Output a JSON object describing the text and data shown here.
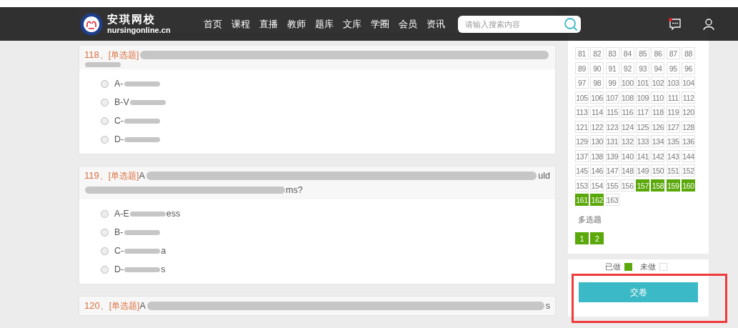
{
  "header": {
    "brand": "安琪网校",
    "domain": "nursingonline.cn",
    "nav": [
      "首页",
      "课程",
      "直播",
      "教师",
      "题库",
      "文库",
      "学圈",
      "会员",
      "资讯"
    ],
    "search": {
      "placeholder": "请输入搜索内容"
    },
    "notification_dot": true
  },
  "questions": [
    {
      "number": "118、",
      "type": "[单选题]",
      "lines": [
        [
          {
            "kind": "redacted-line"
          }
        ],
        [
          {
            "kind": "redacted-word"
          }
        ]
      ],
      "options": [
        {
          "selected": false,
          "parts": [
            {
              "kind": "text",
              "text": "A-"
            },
            {
              "kind": "redacted-word"
            }
          ]
        },
        {
          "selected": false,
          "parts": [
            {
              "kind": "text",
              "text": "B-V"
            },
            {
              "kind": "redacted-word"
            }
          ]
        },
        {
          "selected": false,
          "parts": [
            {
              "kind": "text",
              "text": "C-"
            },
            {
              "kind": "redacted-word"
            }
          ]
        },
        {
          "selected": false,
          "parts": [
            {
              "kind": "text",
              "text": "D-"
            },
            {
              "kind": "redacted-word"
            }
          ]
        }
      ]
    },
    {
      "number": "119、",
      "type": "[单选题]",
      "lines": [
        [
          {
            "kind": "text",
            "text": "A"
          },
          {
            "kind": "redacted-line"
          },
          {
            "kind": "text",
            "text": "uld"
          }
        ],
        [
          {
            "kind": "redacted-long"
          },
          {
            "kind": "text",
            "text": "ms?"
          }
        ]
      ],
      "options": [
        {
          "selected": false,
          "parts": [
            {
              "kind": "text",
              "text": "A-E"
            },
            {
              "kind": "redacted-word"
            },
            {
              "kind": "text",
              "text": "ess"
            }
          ]
        },
        {
          "selected": false,
          "parts": [
            {
              "kind": "text",
              "text": "B-"
            },
            {
              "kind": "redacted-word"
            }
          ]
        },
        {
          "selected": false,
          "parts": [
            {
              "kind": "text",
              "text": "C-"
            },
            {
              "kind": "redacted-word"
            },
            {
              "kind": "text",
              "text": "a"
            }
          ]
        },
        {
          "selected": false,
          "parts": [
            {
              "kind": "text",
              "text": "D-"
            },
            {
              "kind": "redacted-word"
            },
            {
              "kind": "text",
              "text": "s"
            }
          ]
        }
      ]
    },
    {
      "number": "120、",
      "type": "[单选题]",
      "lines": [
        [
          {
            "kind": "text",
            "text": "A"
          },
          {
            "kind": "redacted-line"
          },
          {
            "kind": "text",
            "text": "s"
          }
        ]
      ]
    }
  ],
  "answer_sheet": {
    "single": [
      {
        "label": "81",
        "answered": false
      },
      {
        "label": "82",
        "answered": false
      },
      {
        "label": "83",
        "answered": false
      },
      {
        "label": "84",
        "answered": false
      },
      {
        "label": "85",
        "answered": false
      },
      {
        "label": "86",
        "answered": false
      },
      {
        "label": "87",
        "answered": false
      },
      {
        "label": "88",
        "answered": false
      },
      {
        "label": "89",
        "answered": false
      },
      {
        "label": "90",
        "answered": false
      },
      {
        "label": "91",
        "answered": false
      },
      {
        "label": "92",
        "answered": false
      },
      {
        "label": "93",
        "answered": false
      },
      {
        "label": "94",
        "answered": false
      },
      {
        "label": "95",
        "answered": false
      },
      {
        "label": "96",
        "answered": false
      },
      {
        "label": "97",
        "answered": false
      },
      {
        "label": "98",
        "answered": false
      },
      {
        "label": "99",
        "answered": false
      },
      {
        "label": "100",
        "answered": false
      },
      {
        "label": "101",
        "answered": false
      },
      {
        "label": "102",
        "answered": false
      },
      {
        "label": "103",
        "answered": false
      },
      {
        "label": "104",
        "answered": false
      },
      {
        "label": "105",
        "answered": false
      },
      {
        "label": "106",
        "answered": false
      },
      {
        "label": "107",
        "answered": false
      },
      {
        "label": "108",
        "answered": false
      },
      {
        "label": "109",
        "answered": false
      },
      {
        "label": "110",
        "answered": false
      },
      {
        "label": "111",
        "answered": false
      },
      {
        "label": "112",
        "answered": false
      },
      {
        "label": "113",
        "answered": false
      },
      {
        "label": "114",
        "answered": false
      },
      {
        "label": "115",
        "answered": false
      },
      {
        "label": "116",
        "answered": false
      },
      {
        "label": "117",
        "answered": false
      },
      {
        "label": "118",
        "answered": false
      },
      {
        "label": "119",
        "answered": false
      },
      {
        "label": "120",
        "answered": false
      },
      {
        "label": "121",
        "answered": false
      },
      {
        "label": "122",
        "answered": false
      },
      {
        "label": "123",
        "answered": false
      },
      {
        "label": "124",
        "answered": false
      },
      {
        "label": "125",
        "answered": false
      },
      {
        "label": "126",
        "answered": false
      },
      {
        "label": "127",
        "answered": false
      },
      {
        "label": "128",
        "answered": false
      },
      {
        "label": "129",
        "answered": false
      },
      {
        "label": "130",
        "answered": false
      },
      {
        "label": "131",
        "answered": false
      },
      {
        "label": "132",
        "answered": false
      },
      {
        "label": "133",
        "answered": false
      },
      {
        "label": "134",
        "answered": false
      },
      {
        "label": "135",
        "answered": false
      },
      {
        "label": "136",
        "answered": false
      },
      {
        "label": "137",
        "answered": false
      },
      {
        "label": "138",
        "answered": false
      },
      {
        "label": "139",
        "answered": false
      },
      {
        "label": "140",
        "answered": false
      },
      {
        "label": "141",
        "answered": false
      },
      {
        "label": "142",
        "answered": false
      },
      {
        "label": "143",
        "answered": false
      },
      {
        "label": "144",
        "answered": false
      },
      {
        "label": "145",
        "answered": false
      },
      {
        "label": "146",
        "answered": false
      },
      {
        "label": "147",
        "answered": false
      },
      {
        "label": "148",
        "answered": false
      },
      {
        "label": "149",
        "answered": false
      },
      {
        "label": "150",
        "answered": false
      },
      {
        "label": "151",
        "answered": false
      },
      {
        "label": "152",
        "answered": false
      },
      {
        "label": "153",
        "answered": false
      },
      {
        "label": "154",
        "answered": false
      },
      {
        "label": "155",
        "answered": false
      },
      {
        "label": "156",
        "answered": false
      },
      {
        "label": "157",
        "answered": true
      },
      {
        "label": "158",
        "answered": true
      },
      {
        "label": "159",
        "answered": true
      },
      {
        "label": "160",
        "answered": true
      },
      {
        "label": "161",
        "answered": true
      },
      {
        "label": "162",
        "answered": true
      },
      {
        "label": "163",
        "answered": false
      }
    ],
    "multi_title": "多选题",
    "multi": [
      {
        "label": "1",
        "answered": true
      },
      {
        "label": "2",
        "answered": true
      }
    ],
    "legend": [
      {
        "label": "已做",
        "answered": true
      },
      {
        "label": "未做",
        "answered": false
      }
    ],
    "submit": "交卷"
  }
}
